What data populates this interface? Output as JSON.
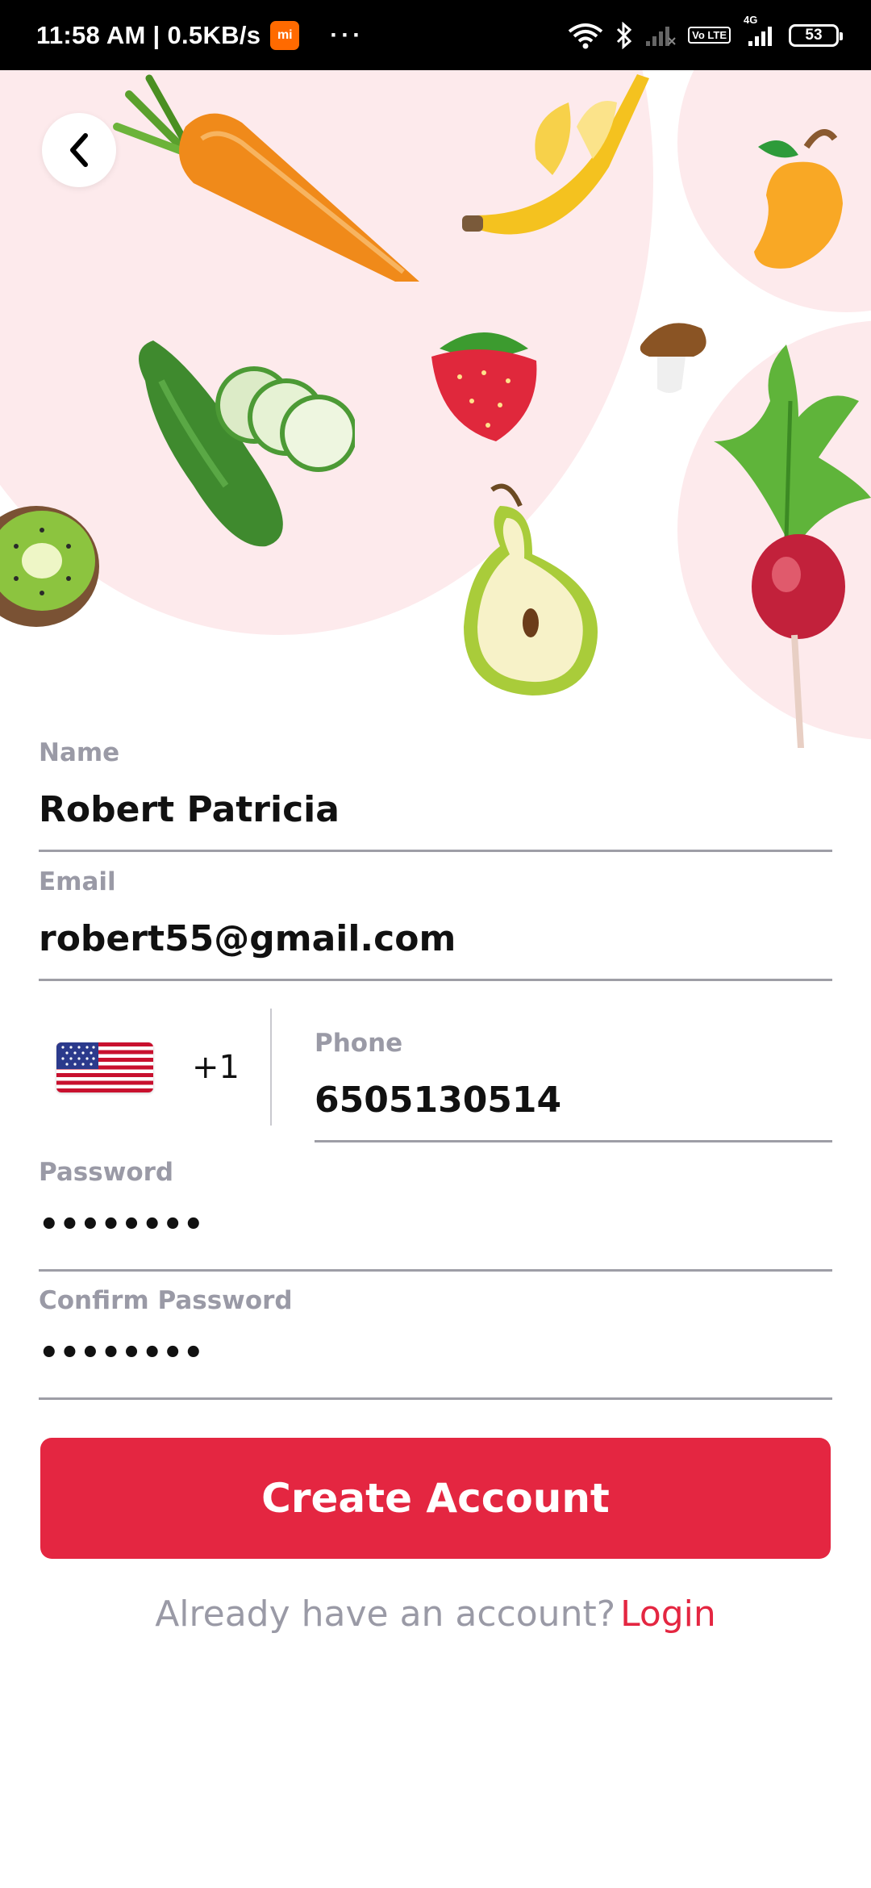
{
  "status_bar": {
    "time_speed": "11:58 AM | 0.5KB/s",
    "mi_badge": "mi",
    "dots": "···",
    "volte": "Vo LTE",
    "network_type": "4G",
    "battery": "53"
  },
  "hero": {
    "back_icon": "chevron-left-icon",
    "illustrations": [
      "carrot",
      "banana",
      "mango",
      "cucumber",
      "strawberry",
      "mushroom",
      "kiwi",
      "pear",
      "radish"
    ],
    "blob_color": "#fdeaec"
  },
  "form": {
    "name": {
      "label": "Name",
      "value": "Robert Patricia"
    },
    "email": {
      "label": "Email",
      "value": "robert55@gmail.com"
    },
    "phone": {
      "country_flag": "us-flag-icon",
      "country_code": "+1",
      "label": "Phone",
      "value": "6505130514"
    },
    "password": {
      "label": "Password",
      "value": "••••••••"
    },
    "confirm_password": {
      "label": "Confirm Password",
      "value": "••••••••"
    }
  },
  "actions": {
    "create_account": "Create Account",
    "login_prompt": "Already have an account?",
    "login_link": "Login"
  },
  "colors": {
    "accent": "#e42641",
    "label": "#9a9aa6",
    "underline": "#9e9ea6"
  }
}
